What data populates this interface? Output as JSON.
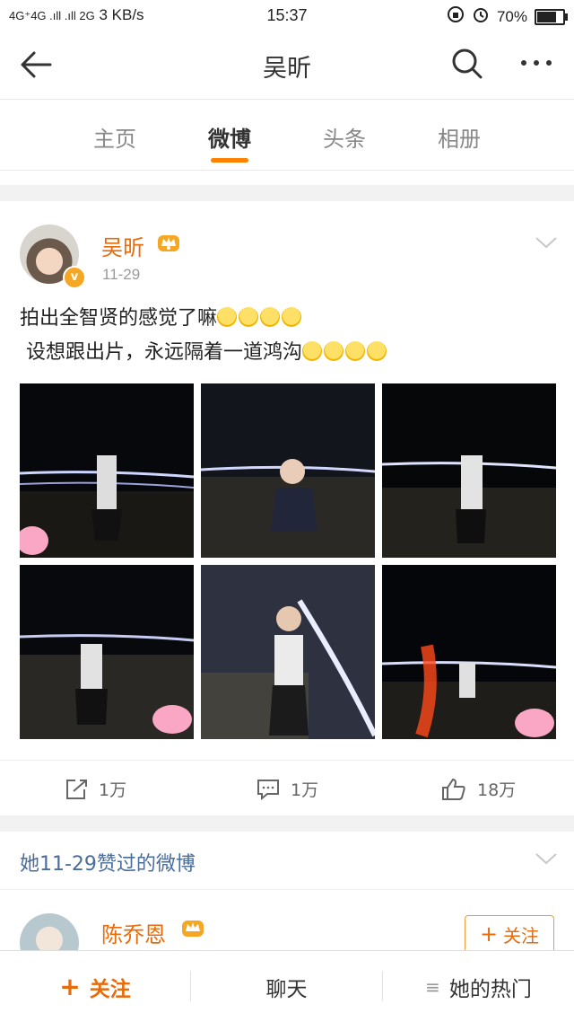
{
  "status_bar": {
    "network": "4G⁺4G .ıll .ıll 2G",
    "speed": "3 KB/s",
    "time": "15:37",
    "battery": "70%",
    "battery_level": 0.7
  },
  "navbar": {
    "title": "吴昕"
  },
  "tabs": [
    {
      "label": "主页",
      "active": false
    },
    {
      "label": "微博",
      "active": true
    },
    {
      "label": "头条",
      "active": false
    },
    {
      "label": "相册",
      "active": false
    }
  ],
  "post": {
    "author": "吴昕",
    "date": "11-29",
    "line1": "拍出全智贤的感觉了嘛",
    "line2": " 设想跟出片，永远隔着一道鸿沟",
    "actions": {
      "repost": "1万",
      "comment": "1万",
      "like": "18万"
    }
  },
  "liked": {
    "title": "她11-29赞过的微博",
    "author": "陈乔恩",
    "follow_label": "关注"
  },
  "bottom_bar": {
    "follow": "关注",
    "chat": "聊天",
    "hot": "她的热门"
  },
  "colors": {
    "accent": "#ff8200",
    "name": "#e86b0c",
    "link": "#4a6d9b"
  }
}
